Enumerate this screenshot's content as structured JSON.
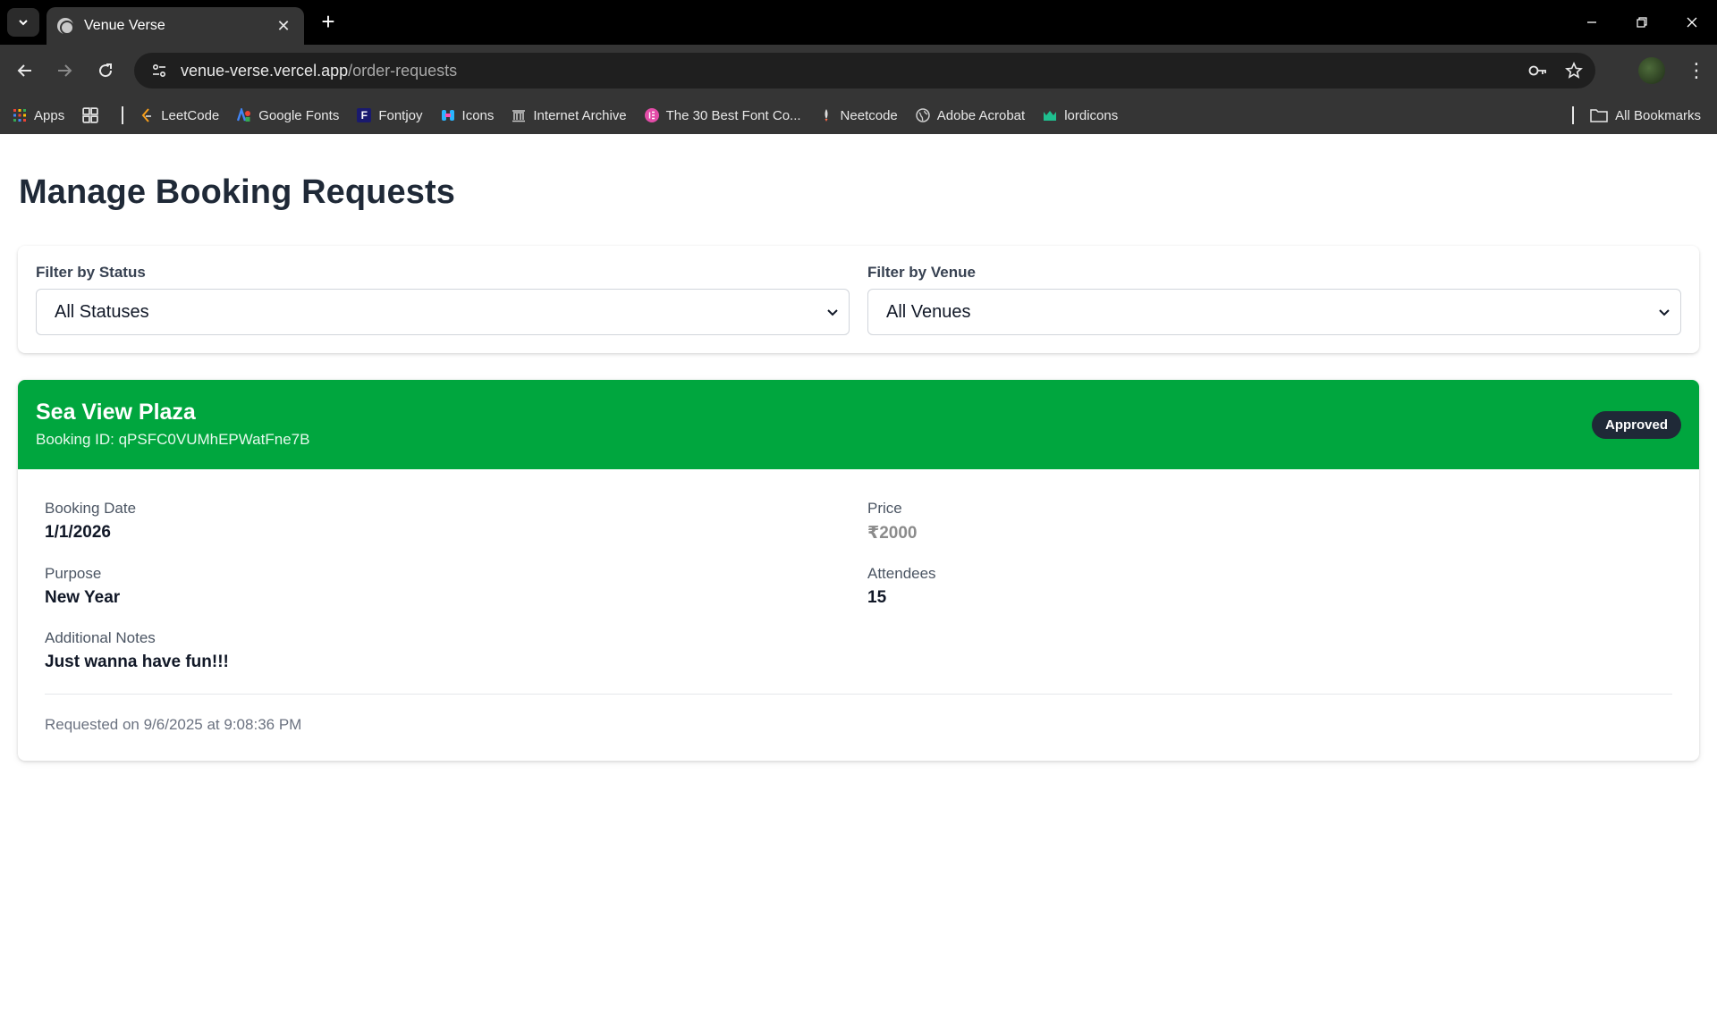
{
  "browser": {
    "tab_title": "Venue Verse",
    "url_host": "venue-verse.vercel.app",
    "url_path": "/order-requests",
    "bookmarks": [
      {
        "label": "Apps",
        "icon": "apps-grid-icon",
        "color": "#ea4335"
      },
      {
        "label": "LeetCode",
        "icon": "leetcode-icon",
        "color": "#f89f1b"
      },
      {
        "label": "Google Fonts",
        "icon": "google-fonts-icon",
        "color": "#4285f4"
      },
      {
        "label": "Fontjoy",
        "icon": "fontjoy-icon",
        "color": "#1a1a6e"
      },
      {
        "label": "Icons",
        "icon": "icons8-icon",
        "color": "#2ab4ff"
      },
      {
        "label": "Internet Archive",
        "icon": "archive-icon",
        "color": "#cccccc"
      },
      {
        "label": "The 30 Best Font Co...",
        "icon": "elementor-icon",
        "color": "#e34ca8"
      },
      {
        "label": "Neetcode",
        "icon": "neetcode-icon",
        "color": "#ff6b4a"
      },
      {
        "label": "Adobe Acrobat",
        "icon": "globe-icon",
        "color": "#cccccc"
      },
      {
        "label": "lordicons",
        "icon": "lordicon-icon",
        "color": "#1fbf8f"
      }
    ],
    "all_bookmarks_label": "All Bookmarks"
  },
  "page": {
    "title": "Manage Booking Requests",
    "filters": {
      "status_label": "Filter by Status",
      "status_value": "All Statuses",
      "venue_label": "Filter by Venue",
      "venue_value": "All Venues"
    },
    "booking": {
      "venue_name": "Sea View Plaza",
      "booking_id_text": "Booking ID: qPSFC0VUMhEPWatFne7B",
      "status": "Approved",
      "header_color": "#00a63e",
      "booking_date_label": "Booking Date",
      "booking_date": "1/1/2026",
      "price_label": "Price",
      "price": "₹2000",
      "purpose_label": "Purpose",
      "purpose": "New Year",
      "attendees_label": "Attendees",
      "attendees": "15",
      "notes_label": "Additional Notes",
      "notes": "Just wanna have fun!!!",
      "requested_text": "Requested on 9/6/2025 at 9:08:36 PM"
    }
  }
}
